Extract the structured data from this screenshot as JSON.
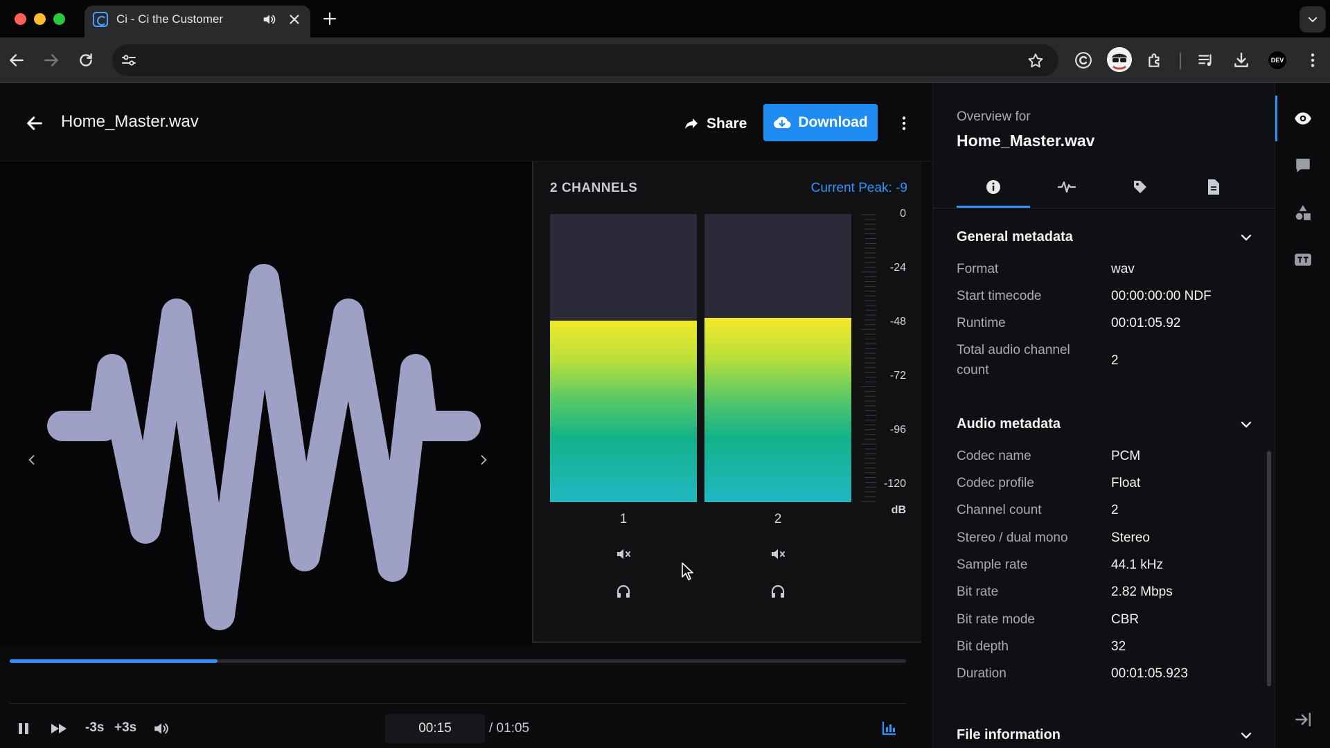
{
  "browser": {
    "tab_title": "Ci - Ci the Customer",
    "profile_badge": "DEV"
  },
  "header": {
    "file_name": "Home_Master.wav",
    "share_label": "Share",
    "download_label": "Download"
  },
  "meter": {
    "channels_label": "2 CHANNELS",
    "current_peak": "Current Peak: -9",
    "db_scale": [
      "0",
      "-24",
      "-48",
      "-72",
      "-96",
      "-120"
    ],
    "db_unit": "dB",
    "channels": [
      {
        "number": "1",
        "level_fraction": 0.63
      },
      {
        "number": "2",
        "level_fraction": 0.64
      }
    ],
    "colors": {
      "accent": "#2d95ff",
      "bar_top": "#f3e92a",
      "bar_mid": "#13b28a",
      "bar_bottom": "#21b8c3"
    }
  },
  "player": {
    "progress_fraction": 0.232,
    "rewind_label": "-3s",
    "forward_label": "+3s",
    "current_time": "00:15",
    "total_time": "/ 01:05"
  },
  "panel": {
    "overview_for": "Overview for",
    "title": "Home_Master.wav",
    "tabs": [
      "info-icon",
      "waveform-icon",
      "tag-icon",
      "document-icon"
    ],
    "sections": [
      {
        "title": "General metadata",
        "rows": [
          {
            "label": "Format",
            "value": "wav"
          },
          {
            "label": "Start timecode",
            "value": "00:00:00:00 NDF"
          },
          {
            "label": "Runtime",
            "value": "00:01:05.92"
          },
          {
            "label": "Total audio channel count",
            "value": "2"
          }
        ]
      },
      {
        "title": "Audio metadata",
        "rows": [
          {
            "label": "Codec name",
            "value": "PCM"
          },
          {
            "label": "Codec profile",
            "value": "Float"
          },
          {
            "label": "Channel count",
            "value": "2"
          },
          {
            "label": "Stereo / dual mono",
            "value": "Stereo"
          },
          {
            "label": "Sample rate",
            "value": "44.1 kHz"
          },
          {
            "label": "Bit rate",
            "value": "2.82 Mbps"
          },
          {
            "label": "Bit rate mode",
            "value": "CBR"
          },
          {
            "label": "Bit depth",
            "value": "32"
          },
          {
            "label": "Duration",
            "value": "00:01:05.923"
          }
        ]
      },
      {
        "title": "File information",
        "rows": []
      }
    ]
  },
  "rail": [
    "eye-icon",
    "comment-icon",
    "shapes-icon",
    "text-track-icon",
    "collapse-panel-icon"
  ]
}
